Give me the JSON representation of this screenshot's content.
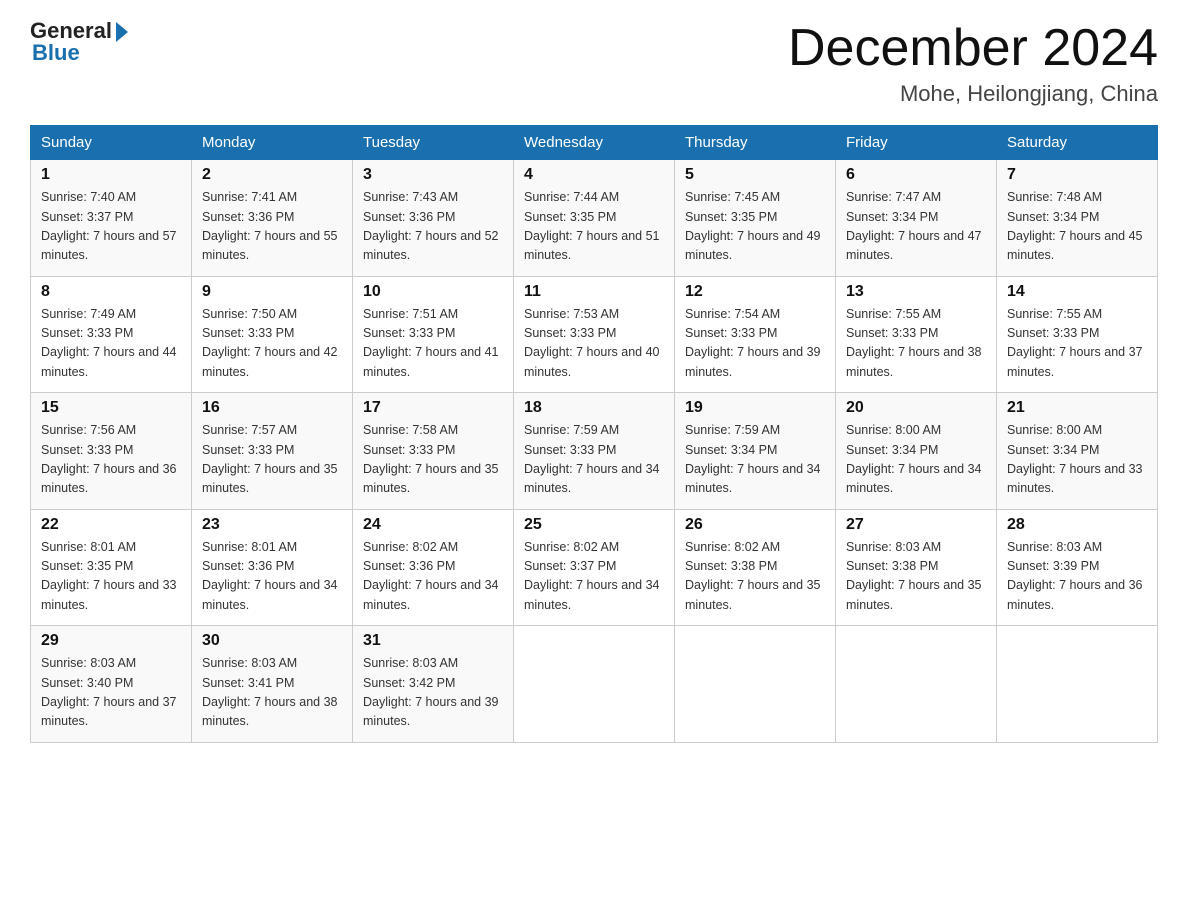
{
  "logo": {
    "text_general": "General",
    "arrow": "▶",
    "text_blue": "Blue"
  },
  "title": "December 2024",
  "location": "Mohe, Heilongjiang, China",
  "days_of_week": [
    "Sunday",
    "Monday",
    "Tuesday",
    "Wednesday",
    "Thursday",
    "Friday",
    "Saturday"
  ],
  "weeks": [
    [
      {
        "day": "1",
        "sunrise": "7:40 AM",
        "sunset": "3:37 PM",
        "daylight": "7 hours and 57 minutes."
      },
      {
        "day": "2",
        "sunrise": "7:41 AM",
        "sunset": "3:36 PM",
        "daylight": "7 hours and 55 minutes."
      },
      {
        "day": "3",
        "sunrise": "7:43 AM",
        "sunset": "3:36 PM",
        "daylight": "7 hours and 52 minutes."
      },
      {
        "day": "4",
        "sunrise": "7:44 AM",
        "sunset": "3:35 PM",
        "daylight": "7 hours and 51 minutes."
      },
      {
        "day": "5",
        "sunrise": "7:45 AM",
        "sunset": "3:35 PM",
        "daylight": "7 hours and 49 minutes."
      },
      {
        "day": "6",
        "sunrise": "7:47 AM",
        "sunset": "3:34 PM",
        "daylight": "7 hours and 47 minutes."
      },
      {
        "day": "7",
        "sunrise": "7:48 AM",
        "sunset": "3:34 PM",
        "daylight": "7 hours and 45 minutes."
      }
    ],
    [
      {
        "day": "8",
        "sunrise": "7:49 AM",
        "sunset": "3:33 PM",
        "daylight": "7 hours and 44 minutes."
      },
      {
        "day": "9",
        "sunrise": "7:50 AM",
        "sunset": "3:33 PM",
        "daylight": "7 hours and 42 minutes."
      },
      {
        "day": "10",
        "sunrise": "7:51 AM",
        "sunset": "3:33 PM",
        "daylight": "7 hours and 41 minutes."
      },
      {
        "day": "11",
        "sunrise": "7:53 AM",
        "sunset": "3:33 PM",
        "daylight": "7 hours and 40 minutes."
      },
      {
        "day": "12",
        "sunrise": "7:54 AM",
        "sunset": "3:33 PM",
        "daylight": "7 hours and 39 minutes."
      },
      {
        "day": "13",
        "sunrise": "7:55 AM",
        "sunset": "3:33 PM",
        "daylight": "7 hours and 38 minutes."
      },
      {
        "day": "14",
        "sunrise": "7:55 AM",
        "sunset": "3:33 PM",
        "daylight": "7 hours and 37 minutes."
      }
    ],
    [
      {
        "day": "15",
        "sunrise": "7:56 AM",
        "sunset": "3:33 PM",
        "daylight": "7 hours and 36 minutes."
      },
      {
        "day": "16",
        "sunrise": "7:57 AM",
        "sunset": "3:33 PM",
        "daylight": "7 hours and 35 minutes."
      },
      {
        "day": "17",
        "sunrise": "7:58 AM",
        "sunset": "3:33 PM",
        "daylight": "7 hours and 35 minutes."
      },
      {
        "day": "18",
        "sunrise": "7:59 AM",
        "sunset": "3:33 PM",
        "daylight": "7 hours and 34 minutes."
      },
      {
        "day": "19",
        "sunrise": "7:59 AM",
        "sunset": "3:34 PM",
        "daylight": "7 hours and 34 minutes."
      },
      {
        "day": "20",
        "sunrise": "8:00 AM",
        "sunset": "3:34 PM",
        "daylight": "7 hours and 34 minutes."
      },
      {
        "day": "21",
        "sunrise": "8:00 AM",
        "sunset": "3:34 PM",
        "daylight": "7 hours and 33 minutes."
      }
    ],
    [
      {
        "day": "22",
        "sunrise": "8:01 AM",
        "sunset": "3:35 PM",
        "daylight": "7 hours and 33 minutes."
      },
      {
        "day": "23",
        "sunrise": "8:01 AM",
        "sunset": "3:36 PM",
        "daylight": "7 hours and 34 minutes."
      },
      {
        "day": "24",
        "sunrise": "8:02 AM",
        "sunset": "3:36 PM",
        "daylight": "7 hours and 34 minutes."
      },
      {
        "day": "25",
        "sunrise": "8:02 AM",
        "sunset": "3:37 PM",
        "daylight": "7 hours and 34 minutes."
      },
      {
        "day": "26",
        "sunrise": "8:02 AM",
        "sunset": "3:38 PM",
        "daylight": "7 hours and 35 minutes."
      },
      {
        "day": "27",
        "sunrise": "8:03 AM",
        "sunset": "3:38 PM",
        "daylight": "7 hours and 35 minutes."
      },
      {
        "day": "28",
        "sunrise": "8:03 AM",
        "sunset": "3:39 PM",
        "daylight": "7 hours and 36 minutes."
      }
    ],
    [
      {
        "day": "29",
        "sunrise": "8:03 AM",
        "sunset": "3:40 PM",
        "daylight": "7 hours and 37 minutes."
      },
      {
        "day": "30",
        "sunrise": "8:03 AM",
        "sunset": "3:41 PM",
        "daylight": "7 hours and 38 minutes."
      },
      {
        "day": "31",
        "sunrise": "8:03 AM",
        "sunset": "3:42 PM",
        "daylight": "7 hours and 39 minutes."
      },
      null,
      null,
      null,
      null
    ]
  ]
}
